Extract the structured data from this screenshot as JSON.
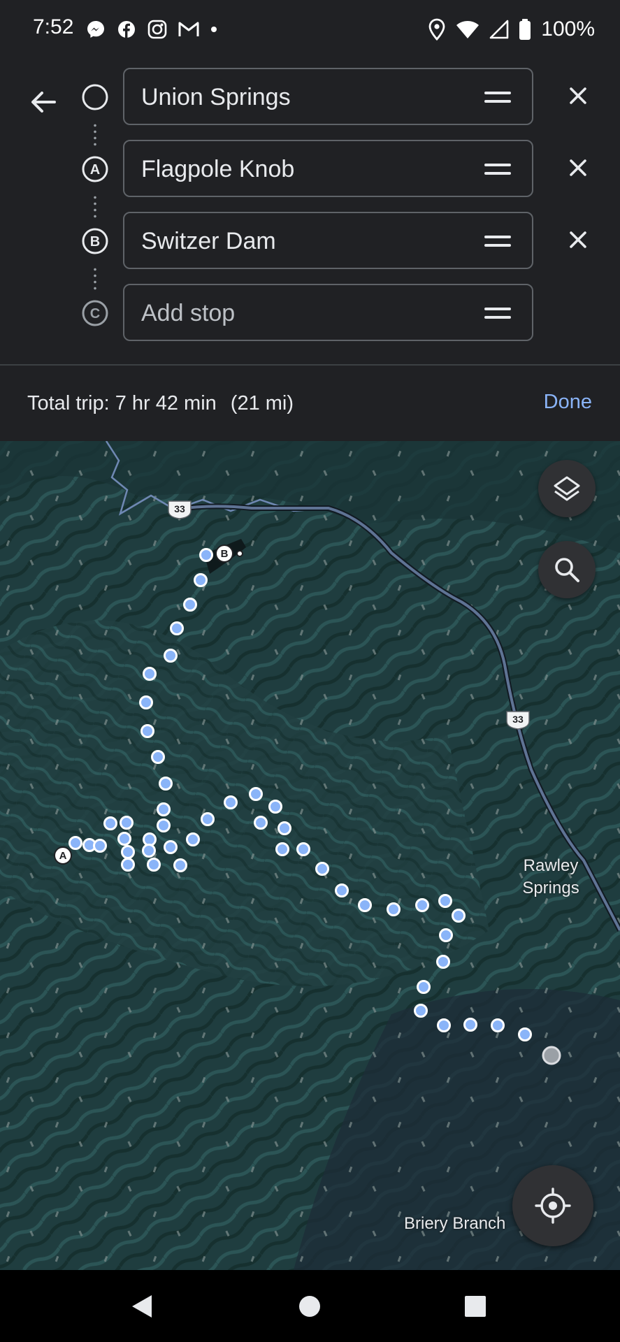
{
  "status_bar": {
    "time": "7:52",
    "left_icons": [
      "messenger-icon",
      "facebook-icon",
      "messenger-kids-icon",
      "gmail-icon",
      "notification-dot-icon"
    ],
    "right_icons": [
      "location-icon",
      "wifi-icon",
      "cell-signal-icon",
      "battery-icon"
    ],
    "battery": "100%"
  },
  "directions": {
    "stops": [
      {
        "marker": "",
        "value": "Union Springs",
        "removable": true
      },
      {
        "marker": "A",
        "value": "Flagpole Knob",
        "removable": true
      },
      {
        "marker": "B",
        "value": "Switzer Dam",
        "removable": true
      },
      {
        "marker": "C",
        "placeholder": "Add stop",
        "value": "",
        "removable": false
      }
    ],
    "trip_label": "Total trip: 7 hr 42 min",
    "trip_distance": "(21 mi)",
    "done_label": "Done"
  },
  "map": {
    "route_shield": "33",
    "route_shield_2": "33",
    "place_rawley": "Rawley\nSprings",
    "place_rawley_line1": "Rawley",
    "place_rawley_line2": "Springs",
    "place_briery": "Briery Branch",
    "marker_a": "A",
    "marker_b": "B",
    "route_color": "#8ab4f8",
    "terrain_color": "#1f3d3f"
  },
  "nav": {
    "icons": [
      "back-triangle-icon",
      "home-circle-icon",
      "recents-square-icon"
    ]
  }
}
